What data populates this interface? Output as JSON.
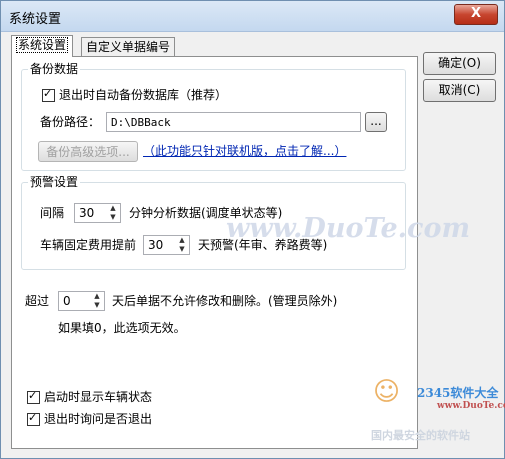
{
  "window": {
    "title": "系统设置",
    "close_label": "X"
  },
  "tabs": [
    {
      "label": "系统设置"
    },
    {
      "label": "自定义单据编号"
    }
  ],
  "side_buttons": {
    "ok": "确定(O)",
    "cancel": "取消(C)"
  },
  "backup": {
    "group_title": "备份数据",
    "auto_backup_label": "退出时自动备份数据库（推荐）",
    "auto_backup_checked": true,
    "path_label": "备份路径：",
    "path_value": "D:\\DBBack",
    "browse_label": "...",
    "advanced_button": "备份高级选项...",
    "advanced_link": "（此功能只针对联机版，点击了解...）"
  },
  "warning": {
    "group_title": "预警设置",
    "interval_label": "间隔",
    "interval_value": "30",
    "interval_suffix": "分钟分析数据(调度单状态等)",
    "fee_label": "车辆固定费用提前",
    "fee_value": "30",
    "fee_suffix": "天预警(年审、养路费等)"
  },
  "lock": {
    "prefix": "超过",
    "value": "0",
    "suffix": "天后单据不允许修改和删除。(管理员除外)",
    "note": "如果填0，此选项无效。"
  },
  "startup": {
    "show_status_label": "启动时显示车辆状态",
    "show_status_checked": true,
    "confirm_exit_label": "退出时询问是否退出",
    "confirm_exit_checked": true
  },
  "watermarks": {
    "main": "www.DuoTe.com",
    "logo": "2345软件大全",
    "url": "www.DuoTe.com",
    "bottom": "国内最安全的软件站"
  },
  "colors": {
    "link": "#0026b3",
    "title_bar": "#c4d8ef",
    "close_button": "#c7452f"
  }
}
